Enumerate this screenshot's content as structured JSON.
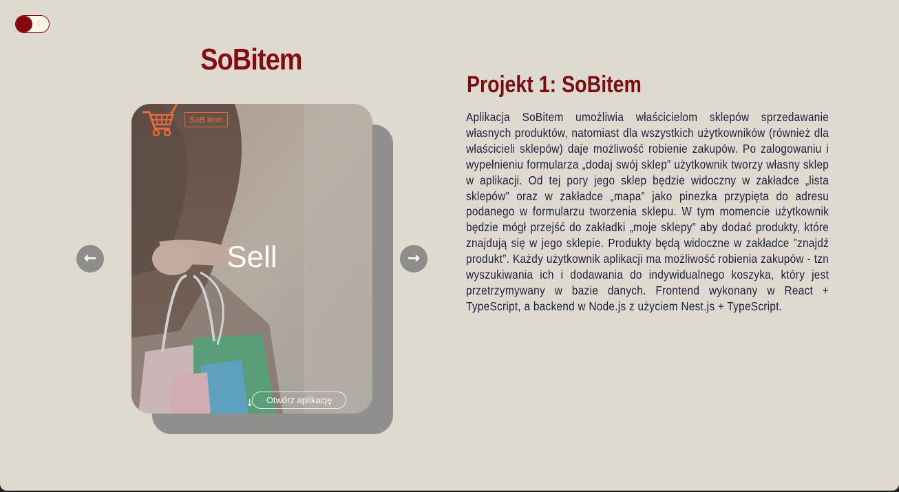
{
  "theme_toggle": {
    "icon": "moon-icon",
    "glyph": "☾"
  },
  "card": {
    "title": "SoBitem",
    "brand": "SoB item",
    "label": "Sell",
    "open_button": "Otwórz aplikację",
    "open_icon": "down-arrow-icon",
    "cart_icon": "shopping-cart-icon"
  },
  "nav": {
    "prev_glyph": "←",
    "next_glyph": "→"
  },
  "project": {
    "heading": "Projekt 1: SoBitem",
    "description": "Aplikacja SoBitem umożliwia właścicielom sklepów sprzedawanie własnych produktów, natomiast dla wszystkich użytkowników (również dla właścicieli sklepów) daje możliwość robienie zakupów. Po zalogowaniu i wypełnieniu formularza „dodaj swój sklep” użytkownik tworzy własny sklep w aplikacji. Od tej pory jego sklep będzie widoczny w zakładce „lista sklepów” oraz w zakładce „mapa” jako pinezka przypięta do adresu podanego w formularzu tworzenia sklepu. W tym momencie użytkownik będzie mógł przejść do zakładki „moje sklepy” aby dodać produkty, które znajdują się w jego sklepie. Produkty będą widoczne w zakładce ”znajdź produkt”. Każdy użytkownik aplikacji ma możliwość robienia zakupów - tzn wyszukiwania ich i dodawania do indywidualnego koszyka, który jest przetrzymywany w bazie danych. Frontend wykonany w React + TypeScript, a backend w Node.js z użyciem Nest.js + TypeScript."
  },
  "colors": {
    "background": "#dedad0",
    "accent": "#850a12",
    "text": "#1c1f3c",
    "brand_orange": "#ea6a3d"
  }
}
